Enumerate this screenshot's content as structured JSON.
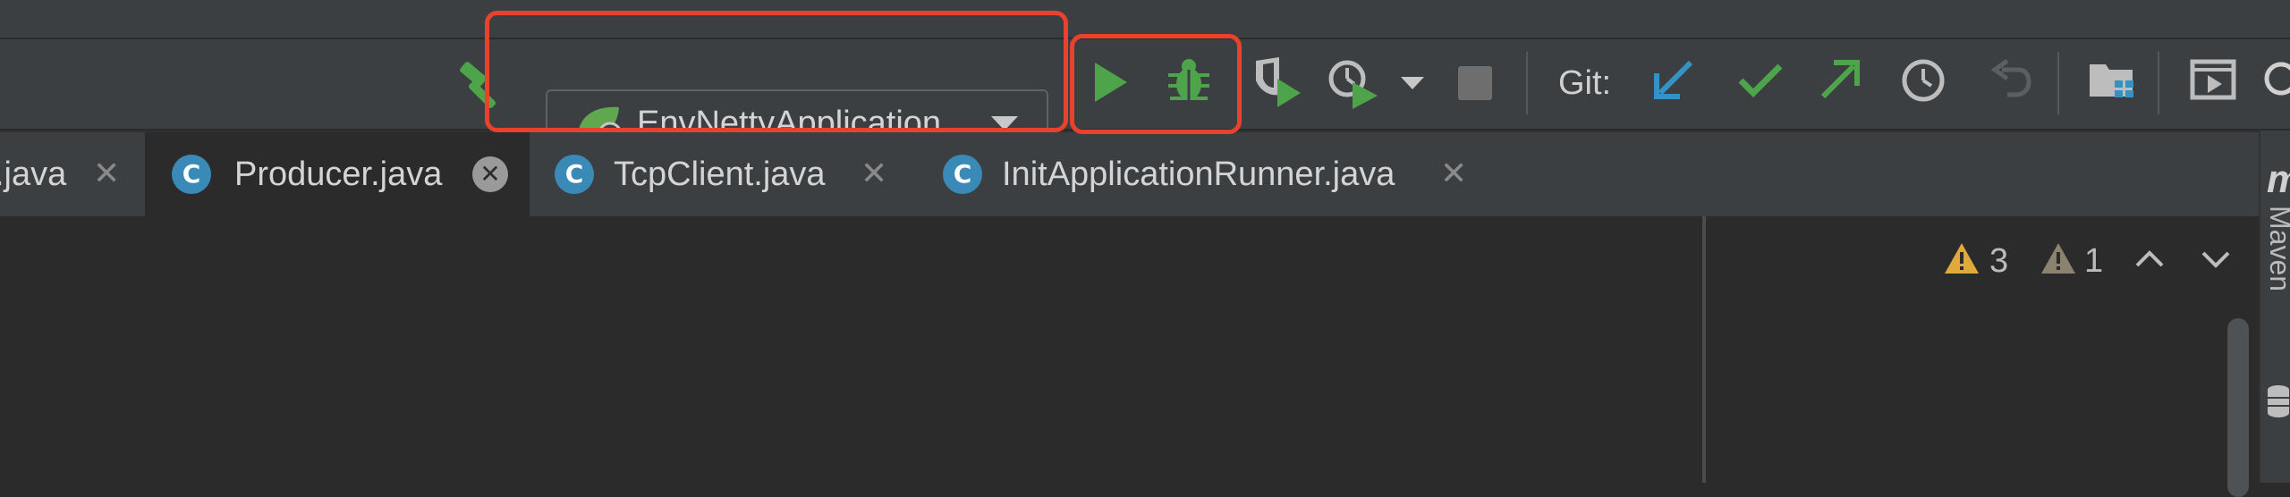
{
  "toolbar": {
    "run_configuration": "EnvNettyApplication",
    "git_label": "Git:"
  },
  "tabs": [
    {
      "label": ".java",
      "icon": "C",
      "active": false
    },
    {
      "label": "Producer.java",
      "icon": "C",
      "active": true
    },
    {
      "label": "TcpClient.java",
      "icon": "C",
      "active": false
    },
    {
      "label": "InitApplicationRunner.java",
      "icon": "C",
      "active": false
    }
  ],
  "inspections": {
    "warnings": "3",
    "weak_warnings": "1"
  },
  "right_stripe": {
    "maven_label": "Maven"
  },
  "colors": {
    "toolbar_bg": "#3c3f41",
    "editor_bg": "#2b2b2b",
    "run_green": "#4ea44b",
    "git_update_blue": "#3592c4",
    "highlight_red": "#e8412c",
    "warning_yellow": "#e0a93b"
  }
}
